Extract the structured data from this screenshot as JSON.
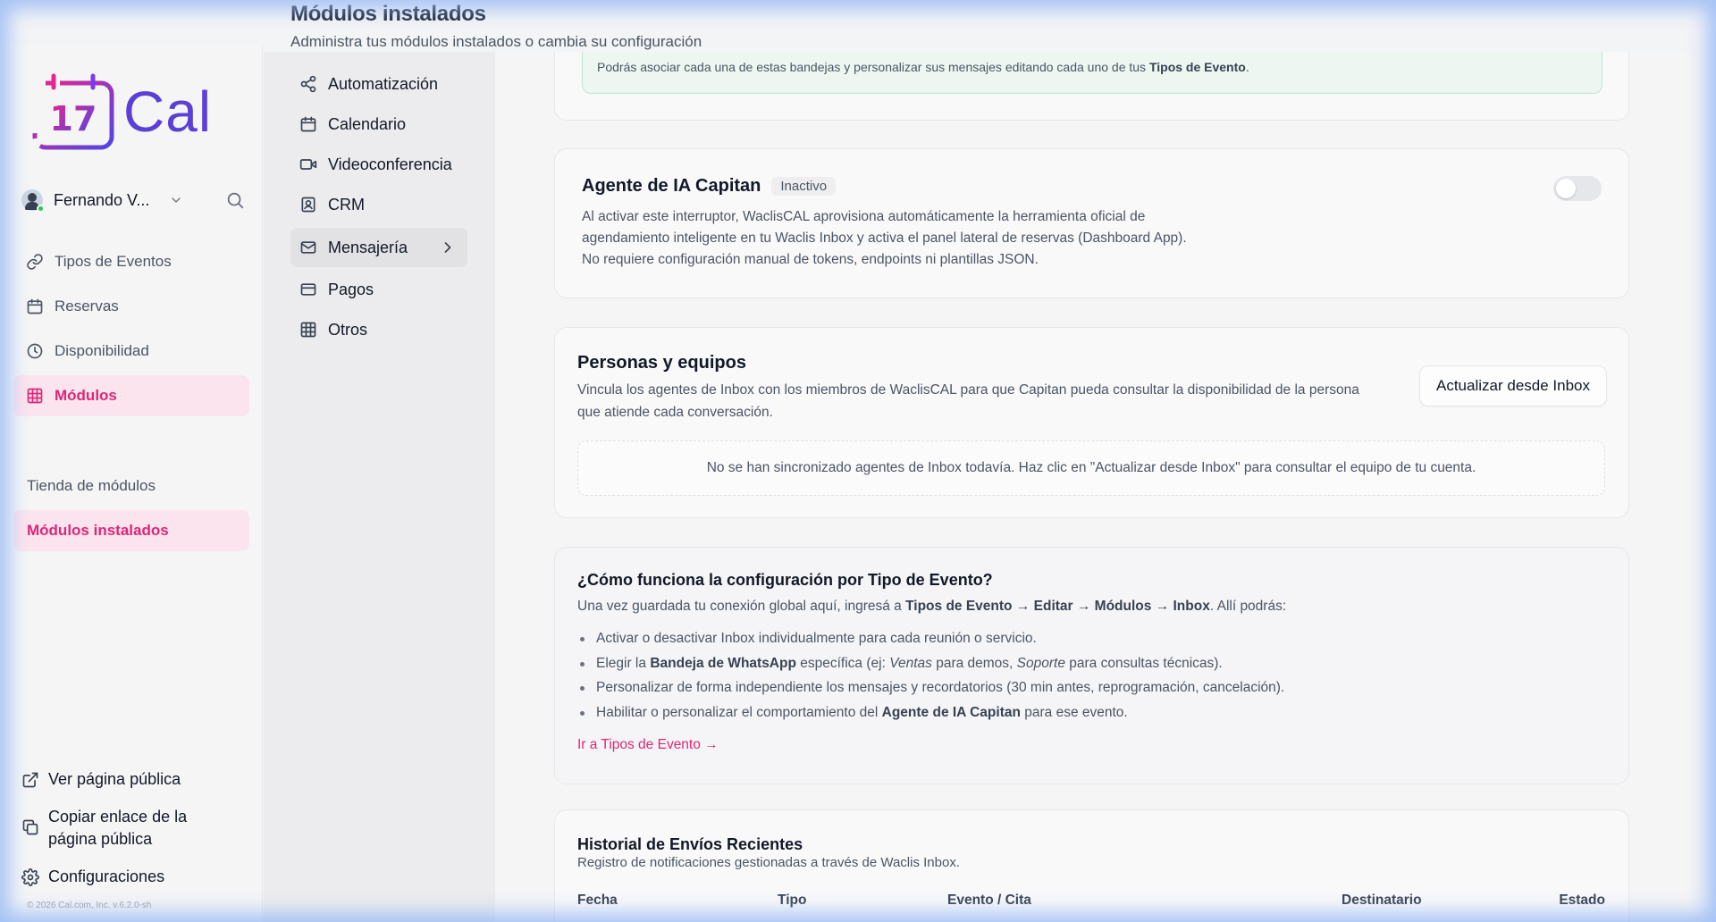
{
  "brand": {
    "logo_number": "17",
    "logo_text": "Cal"
  },
  "user": {
    "name": "Fernando V..."
  },
  "sidebar": {
    "items": [
      {
        "label": "Tipos de Eventos"
      },
      {
        "label": "Reservas"
      },
      {
        "label": "Disponibilidad"
      },
      {
        "label": "Módulos"
      },
      {
        "label": "Tienda de módulos"
      },
      {
        "label": "Módulos instalados"
      }
    ],
    "bottom": {
      "public_page": "Ver página pública",
      "copy_link": "Copiar enlace de la página pública",
      "settings": "Configuraciones"
    },
    "copyright": "© 2026 Cal.com, Inc. v.6.2.0-sh"
  },
  "header": {
    "title": "Módulos instalados",
    "subtitle": "Administra tus módulos instalados o cambia su configuración"
  },
  "subnav": {
    "items": [
      {
        "label": "Automatización"
      },
      {
        "label": "Calendario"
      },
      {
        "label": "Videoconferencia"
      },
      {
        "label": "CRM"
      },
      {
        "label": "Mensajería"
      },
      {
        "label": "Pagos"
      },
      {
        "label": "Otros"
      }
    ]
  },
  "note": {
    "prefix": "Podrás asociar cada una de estas bandejas y personalizar sus mensajes editando cada uno de tus ",
    "bold": "Tipos de Evento",
    "suffix": "."
  },
  "agent": {
    "title": "Agente de IA Capitan",
    "badge": "Inactivo",
    "desc_1": "Al activar este interruptor, WaclisCAL aprovisiona automáticamente la herramienta oficial de",
    "desc_2": "agendamiento inteligente en tu Waclis Inbox y activa el panel lateral de reservas (Dashboard App).",
    "desc_3": "No requiere configuración manual de tokens, endpoints ni plantillas JSON.",
    "toggle_on": false
  },
  "people": {
    "title": "Personas y equipos",
    "desc_1": "Vincula los agentes de Inbox con los miembros de WaclisCAL para que Capitan pueda consultar la disponibilidad de la persona",
    "desc_2": "que atiende cada conversación.",
    "button": "Actualizar desde Inbox",
    "empty": "No se han sincronizado agentes de Inbox todavía. Haz clic en \"Actualizar desde Inbox\" para consultar el equipo de tu cuenta."
  },
  "how": {
    "title": "¿Cómo funciona la configuración por Tipo de Evento?",
    "intro_prefix": "Una vez guardada tu conexión global aquí, ingresá a ",
    "intro_bold": "Tipos de Evento → Editar → Módulos → Inbox",
    "intro_suffix": ". Allí podrás:",
    "b1": "Activar o desactivar Inbox individualmente para cada reunión o servicio.",
    "b2_prefix": "Elegir la ",
    "b2_bold": "Bandeja de WhatsApp",
    "b2_mid": " específica (ej: ",
    "b2_em1": "Ventas",
    "b2_mid2": " para demos, ",
    "b2_em2": "Soporte",
    "b2_suffix": " para consultas técnicas).",
    "b3": "Personalizar de forma independiente los mensajes y recordatorios (30 min antes, reprogramación, cancelación).",
    "b4_prefix": "Habilitar o personalizar el comportamiento del ",
    "b4_bold": "Agente de IA Capitan",
    "b4_suffix": " para ese evento.",
    "link": "Ir a Tipos de Evento →"
  },
  "history": {
    "title": "Historial de Envíos Recientes",
    "subtitle": "Registro de notificaciones gestionadas a través de Waclis Inbox.",
    "columns": [
      "Fecha",
      "Tipo",
      "Evento / Cita",
      "Destinatario",
      "Estado"
    ]
  },
  "colors": {
    "accent": "#db2777",
    "brand": "#5b3fd6"
  }
}
